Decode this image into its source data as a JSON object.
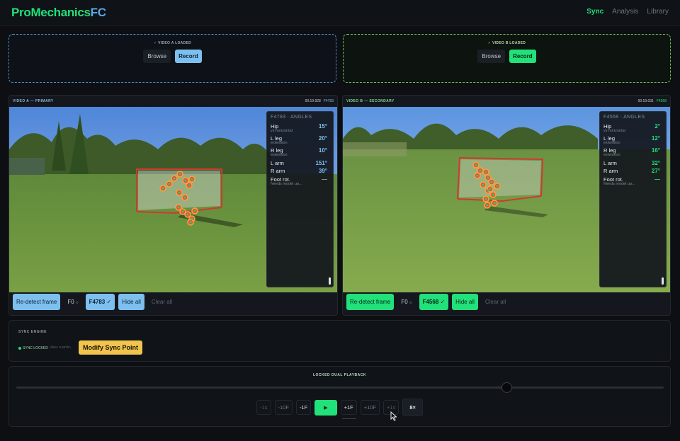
{
  "header": {
    "brand_main": "ProMechanics",
    "brand_suffix": "FC",
    "nav": [
      "Sync",
      "Analysis",
      "Library"
    ]
  },
  "upload": {
    "a": {
      "status": "✓ VIDEO A LOADED",
      "browse": "Browse",
      "record": "Record"
    },
    "b": {
      "status": "✓ VIDEO B LOADED",
      "browse": "Browse",
      "record": "Record"
    }
  },
  "video_a": {
    "title": "VIDEO A — PRIMARY",
    "timecode": "00:19.928",
    "frame": "F4783",
    "angles": {
      "header": "F4783 · ANGLES",
      "rows": [
        {
          "name": "Hip",
          "sub": "vs horizontal",
          "value": "15°"
        },
        {
          "name": "L leg",
          "sub": "extension",
          "value": "20°"
        },
        {
          "name": "R leg",
          "sub": "extension",
          "value": "10°"
        },
        {
          "name": "L arm",
          "sub": "",
          "value": "151°"
        },
        {
          "name": "R arm",
          "sub": "",
          "value": "39°"
        },
        {
          "name": "Foot rot.",
          "sub": "Needs model up...",
          "value": "—"
        }
      ]
    },
    "controls": {
      "redetect": "Re-detect frame",
      "f0": "F0",
      "frame_btn": "F4783 ✓",
      "hide_all": "Hide all",
      "clear_all": "Clear all"
    }
  },
  "video_b": {
    "title": "VIDEO B — SECONDARY",
    "timecode": "00:19.031",
    "frame": "F4568",
    "angles": {
      "header": "F4568 · ANGLES",
      "rows": [
        {
          "name": "Hip",
          "sub": "vs horizontal",
          "value": "2°"
        },
        {
          "name": "L leg",
          "sub": "extension",
          "value": "12°"
        },
        {
          "name": "R leg",
          "sub": "extension",
          "value": "16°"
        },
        {
          "name": "L arm",
          "sub": "",
          "value": "32°"
        },
        {
          "name": "R arm",
          "sub": "",
          "value": "27°"
        },
        {
          "name": "Foot rot.",
          "sub": "Needs model up...",
          "value": "—"
        }
      ]
    },
    "controls": {
      "redetect": "Re-detect frame",
      "f0": "F0",
      "frame_btn": "F4568 ✓",
      "hide_all": "Hide all",
      "clear_all": "Clear all"
    }
  },
  "sync_engine": {
    "label": "SYNC ENGINE",
    "status": "SYNC LOCKED",
    "offset": "offset: 0.897fm",
    "modify": "Modify Sync Point"
  },
  "playback": {
    "label": "LOCKED DUAL PLAYBACK",
    "progress": 0.755,
    "buttons": [
      "-1s",
      "-10F",
      "-1F",
      "▶",
      "+1F",
      "+10F",
      "+1s",
      "8×"
    ]
  },
  "colors": {
    "accent_green": "#22e07a",
    "accent_blue": "#7dc0ef",
    "sync_yellow": "#f0c44d",
    "joint_red": "#f04a3c"
  },
  "icons": {
    "cursor": "arrow-cursor-icon",
    "check": "check-icon"
  }
}
